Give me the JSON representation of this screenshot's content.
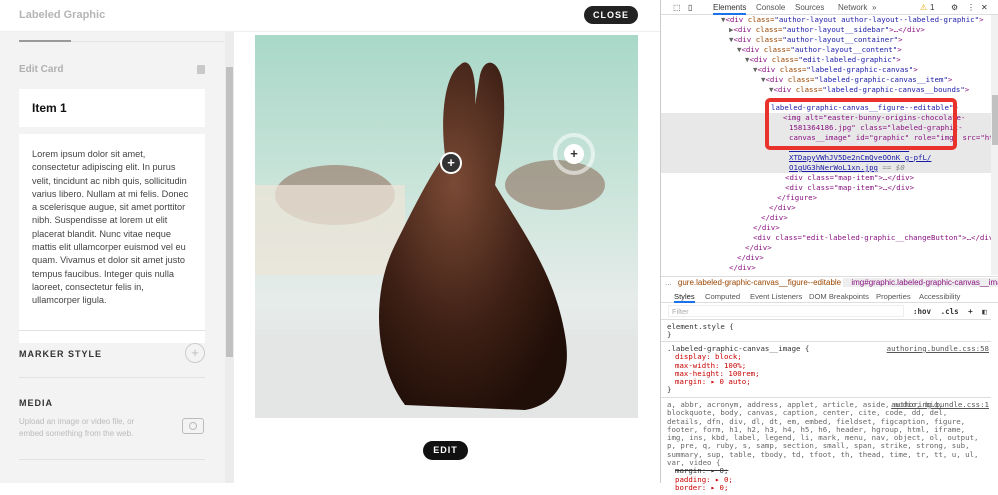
{
  "app": {
    "title": "Labeled Graphic",
    "close_label": "CLOSE",
    "edit_label": "EDIT"
  },
  "sidebar": {
    "edit_card": "Edit Card",
    "item_title": "Item 1",
    "item_body": "Lorem ipsum dolor sit amet, consectetur adipiscing elit. In purus velit, tincidunt ac nibh quis, sollicitudin varius libero. Nullam at mi felis. Donec a scelerisque augue, sit amet porttitor nibh. Suspendisse at lorem ut elit placerat blandit. Nunc vitae neque mattis elit ullamcorper euismod vel eu quam. Vivamus et dolor sit amet justo tempus faucibus. Integer quis nulla laoreet, consectetur felis in, ullamcorper ligula.",
    "marker_style": "MARKER STYLE",
    "media": "MEDIA",
    "media_desc": "Upload an image or video file, or embed something from the web."
  },
  "markers": [
    {
      "label": "+"
    },
    {
      "label": "+"
    }
  ],
  "devtools": {
    "tabs": [
      "Elements",
      "Console",
      "Sources",
      "Network",
      "»"
    ],
    "warnings": "1",
    "tree": [
      {
        "tag": "<div ",
        "attr": "class=",
        "val": "\"author-layout author-layout--labeled-graphic\"",
        "end": ">"
      },
      {
        "tag": "<div ",
        "attr": "class=",
        "val": "\"author-layout__sidebar\"",
        "end": ">…</div>"
      },
      {
        "tag": "<div ",
        "attr": "class=",
        "val": "\"author-layout__container\"",
        "end": ">"
      },
      {
        "tag": "<div ",
        "attr": "class=",
        "val": "\"author-layout__content\"",
        "end": ">"
      },
      {
        "tag": "<div ",
        "attr": "class=",
        "val": "\"edit-labeled-graphic\"",
        "end": ">"
      },
      {
        "tag": "<div ",
        "attr": "class=",
        "val": "\"labeled-graphic-canvas\"",
        "end": ">"
      },
      {
        "tag": "<div ",
        "attr": "class=",
        "val": "\"labeled-graphic-canvas__item\"",
        "end": ">"
      },
      {
        "tag": "<div ",
        "attr": "class=",
        "val": "\"labeled-graphic-canvas__bounds\"",
        "end": ">"
      }
    ],
    "figure_line": "labeled-graphic-canvas__figure--editable\">",
    "img_lines": [
      "<img alt=\"easter-bunny-origins-chocolate-",
      "1581364186.jpg\" class=\"labeled-graphic-",
      "canvas__image\" id=\"graphic\" role=\"img\" src=\"https:/"
    ],
    "src_lines": [
      "XTDapyVWhJV5De2nCmQveOOnK_g-pfL/",
      "O1gUG3hNerWoL1xn.jpg"
    ],
    "eq": "== $0",
    "after": [
      "<div class=\"map-item\">…</div>",
      "<div class=\"map-item\">…</div>",
      "</figure>",
      "</div>",
      "</div>",
      "</div>",
      "<div class=\"edit-labeled-graphic__changeButton\">…</div>",
      "</div>",
      "</div>",
      "</div>"
    ],
    "crumbs": [
      "...",
      "gure.labeled-graphic-canvas__figure--editable",
      "img#graphic.labeled-graphic-canvas__image",
      "..."
    ],
    "style_tabs": [
      "Styles",
      "Computed",
      "Event Listeners",
      "DOM Breakpoints",
      "Properties",
      "Accessibility"
    ],
    "filter_placeholder": "Filter",
    "hov": ":hov",
    "cls": ".cls",
    "plus": "+",
    "element_style": "element.style {",
    "close_brace": "}",
    "rule1": {
      "selector": ".labeled-graphic-canvas__image {",
      "source": "authoring.bundle.css:58",
      "props": [
        "display: block;",
        "max-width: 100%;",
        "max-height: 100rem;",
        "margin: ▸ 0 auto;"
      ]
    },
    "rule2": {
      "source": "authoring.bundle.css:1",
      "selector": "a, abbr, acronym, address, applet, article, aside, audio, big, blockquote, body, canvas, caption, center, cite, code, dd, del, details, dfn, div, dl, dt, em, embed, fieldset, figcaption, figure, footer, form, h1, h2, h3, h4, h5, h6, header, hgroup, html, iframe, img, ins, kbd, label, legend, li, mark, menu, nav, object, ol, output, p, pre, q, ruby, s, samp, section, small, span, strike, strong, sub, summary, sup, table, tbody, td, tfoot, th, thead, time, tr, tt, u, ul, var, video {",
      "props": [
        "margin: ▸ 0;",
        "padding: ▸ 0;",
        "border: ▸ 0;"
      ]
    }
  }
}
